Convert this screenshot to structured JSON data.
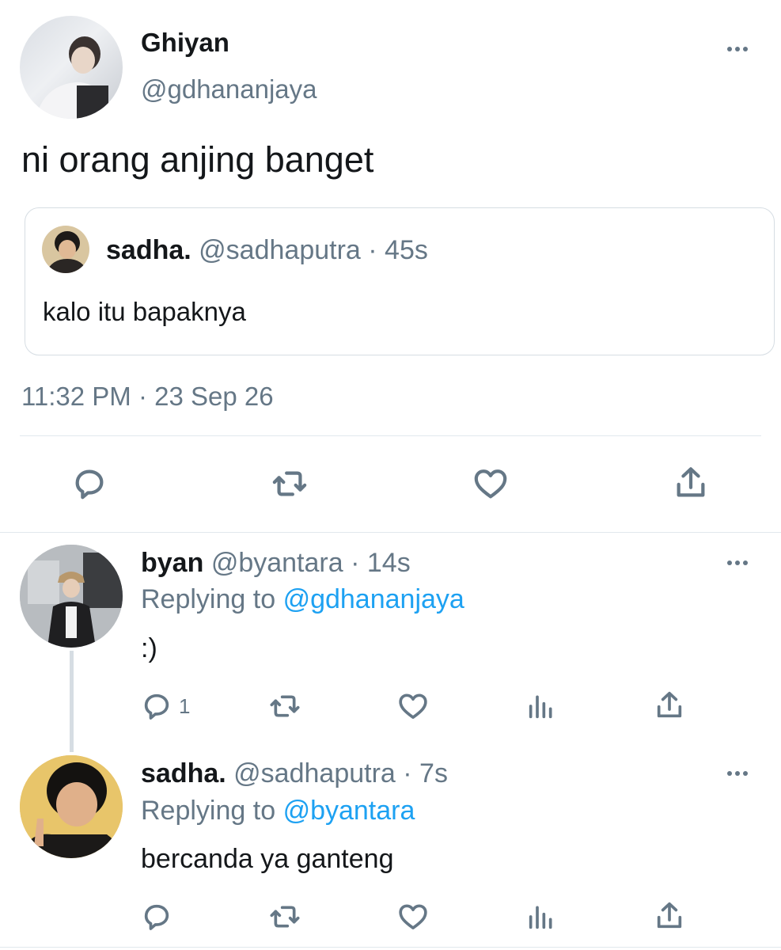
{
  "main_tweet": {
    "display_name": "Ghiyan",
    "handle": "@gdhananjaya",
    "text": "ni orang anjing banget",
    "timestamp": "11:32 PM · 23 Sep 26",
    "quoted": {
      "display_name": "sadha.",
      "handle": "@sadhaputra",
      "time": "· 45s",
      "text": "kalo itu bapaknya"
    }
  },
  "replies": [
    {
      "display_name": "byan",
      "handle": "@byantara",
      "time": "· 14s",
      "replying_prefix": "Replying to",
      "replying_to": "@gdhananjaya",
      "text": ":)",
      "reply_count": "1"
    },
    {
      "display_name": "sadha.",
      "handle": "@sadhaputra",
      "time": "· 7s",
      "replying_prefix": "Replying to",
      "replying_to": "@byantara",
      "text": "bercanda ya ganteng",
      "reply_count": ""
    }
  ],
  "icons": [
    "reply-icon",
    "retweet-icon",
    "like-icon",
    "analytics-icon",
    "share-icon",
    "more-icon"
  ],
  "colors": {
    "text": "#14171a",
    "muted": "#657786",
    "link": "#1da1f2",
    "border": "#e1e8ed"
  }
}
